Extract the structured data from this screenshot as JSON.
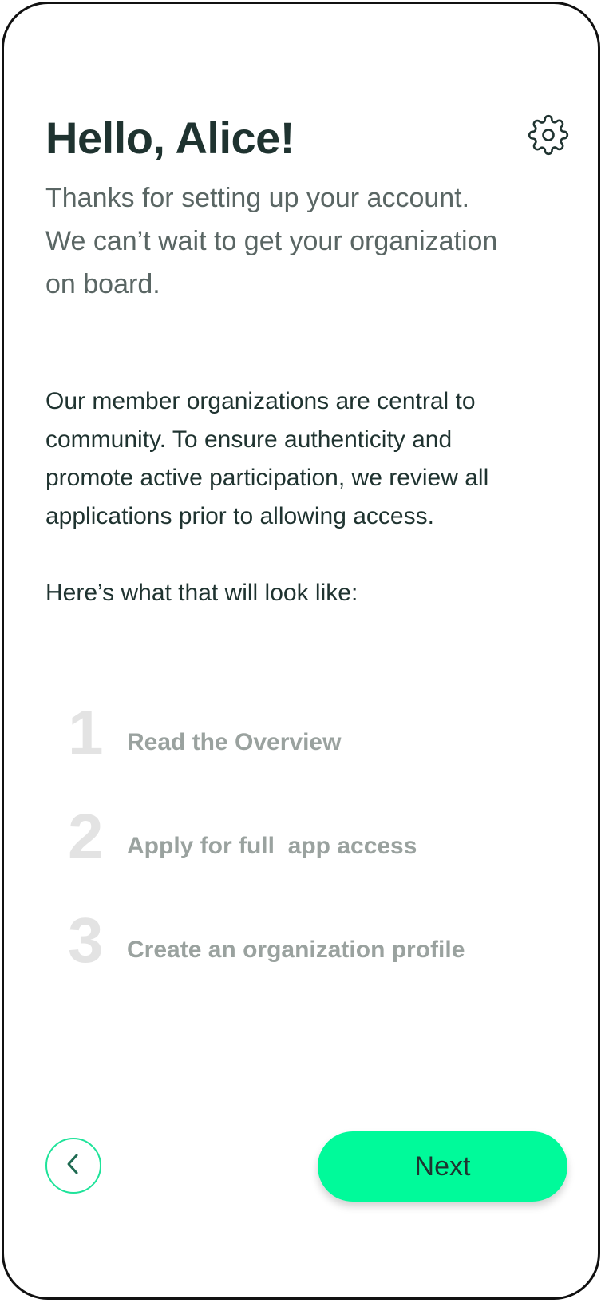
{
  "header": {
    "greeting": "Hello, Alice!",
    "settings_icon": "gear-icon"
  },
  "subtitle": {
    "lines": [
      "Thanks for setting up your account.",
      "We can’t wait to get your organization",
      "on board."
    ]
  },
  "intro": {
    "lines": [
      "Our member organizations are central to",
      "community. To ensure authenticity and",
      "promote active participation, we review all",
      "applications prior to allowing access."
    ]
  },
  "lead": "Here’s what that will look like:",
  "steps": [
    {
      "number": "1",
      "label": "Read the Overview"
    },
    {
      "number": "2",
      "label": "Apply for full  app access"
    },
    {
      "number": "3",
      "label": "Create an organization profile"
    }
  ],
  "footer": {
    "back_icon": "chevron-left-icon",
    "next_label": "Next"
  },
  "colors": {
    "accent": "#00fa9a",
    "text_dark": "#1f3330",
    "step_number": "#e3e3e3",
    "step_label": "#9aa29f"
  }
}
